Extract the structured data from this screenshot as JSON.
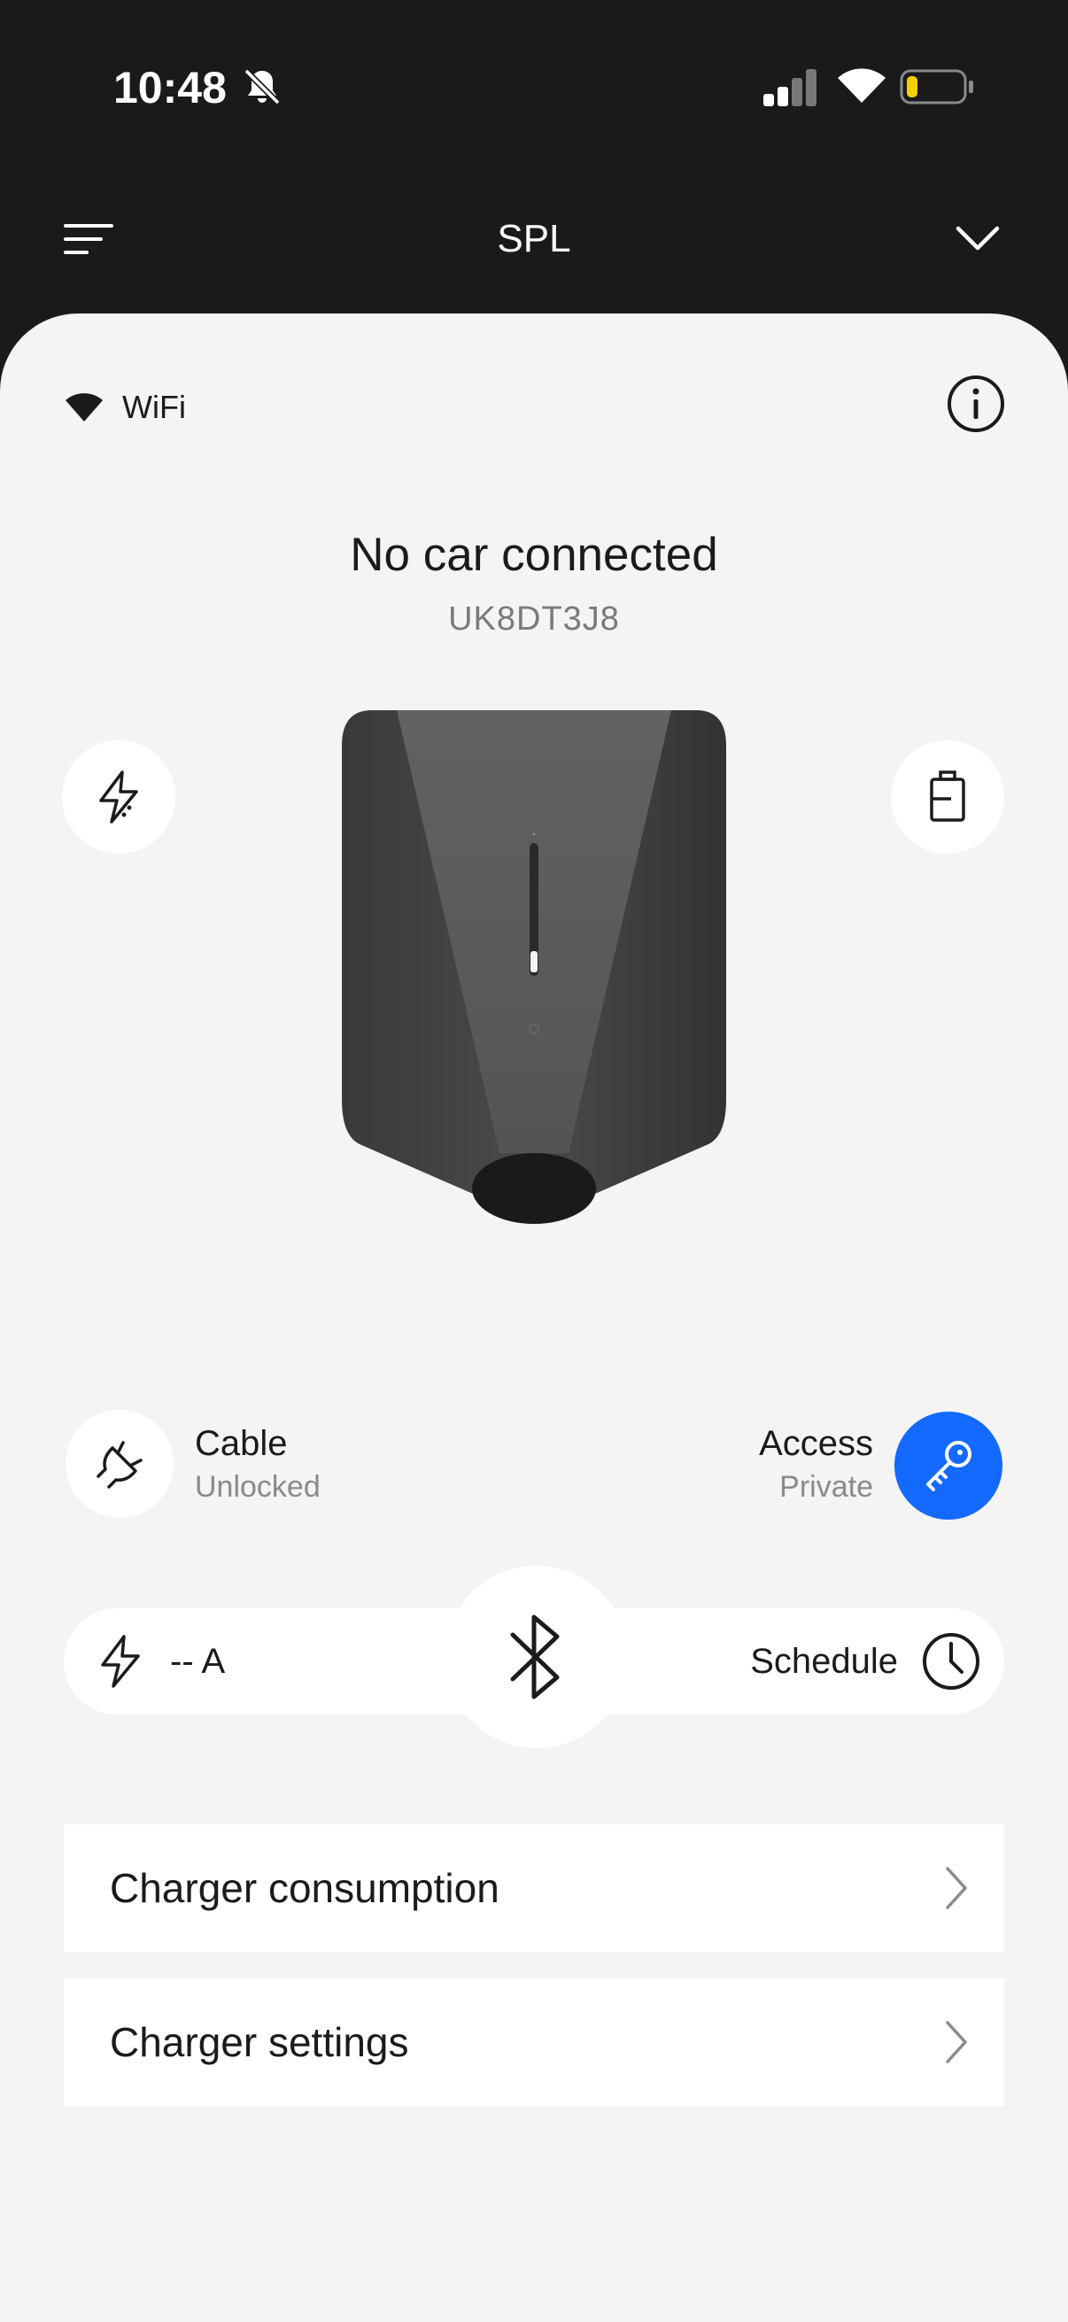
{
  "status_bar": {
    "time": "10:48",
    "icons": [
      "bell-slash-icon",
      "signal-icon",
      "wifi-icon",
      "battery-icon"
    ],
    "battery_color": "#f5d000"
  },
  "header": {
    "title": "SPL",
    "menu_icon": "menu-icon",
    "chevron_icon": "chevron-down-icon"
  },
  "connection": {
    "label": "WiFi",
    "icon": "wifi-icon"
  },
  "charger": {
    "status": "No car connected",
    "serial": "UK8DT3J8"
  },
  "cable": {
    "label": "Cable",
    "status": "Unlocked"
  },
  "access": {
    "label": "Access",
    "status": "Private",
    "accent_color": "#1469ff"
  },
  "controls": {
    "current": "-- A",
    "schedule": "Schedule"
  },
  "menu": {
    "items": [
      {
        "label": "Charger consumption"
      },
      {
        "label": "Charger settings"
      }
    ]
  }
}
